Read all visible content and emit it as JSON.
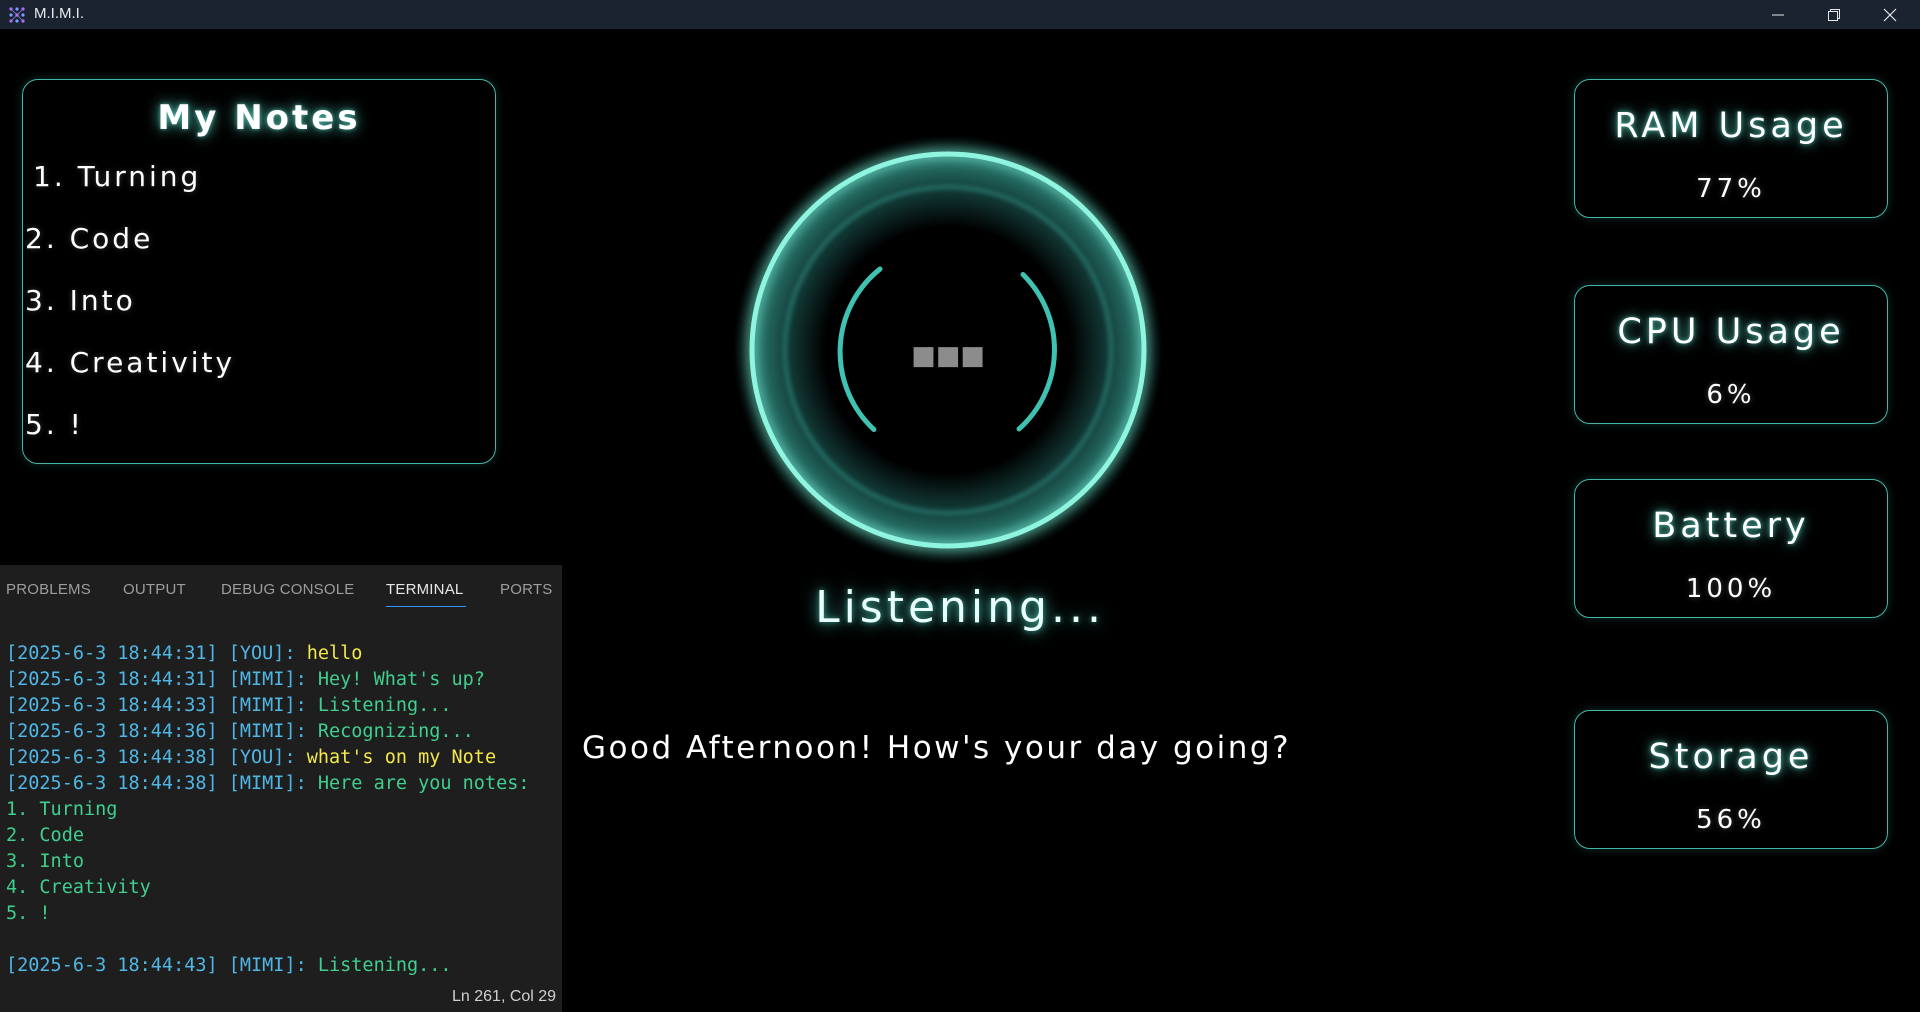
{
  "window": {
    "title": "M.I.M.I.",
    "icons": {
      "logo": "mimi-logo-icon",
      "minimize": "minimize-icon",
      "restore": "restore-icon",
      "close": "close-icon"
    }
  },
  "notes": {
    "title": "My Notes",
    "items": [
      "1. Turning",
      "2. Code",
      "3. Into",
      "4. Creativity",
      "5. !"
    ]
  },
  "assistant": {
    "status": "Listening...",
    "orb_center": "■■■",
    "greeting": "Good Afternoon! How's your day going?"
  },
  "stats": {
    "ram": {
      "label": "RAM Usage",
      "value": "77%"
    },
    "cpu": {
      "label": "CPU Usage",
      "value": "6%"
    },
    "battery": {
      "label": "Battery",
      "value": "100%"
    },
    "storage": {
      "label": "Storage",
      "value": "56%"
    }
  },
  "terminal": {
    "tabs": [
      "PROBLEMS",
      "OUTPUT",
      "DEBUG CONSOLE",
      "TERMINAL",
      "PORTS"
    ],
    "active_tab": "TERMINAL",
    "log": [
      {
        "prefix": "[2025-6-3 18:44:31] [YOU]: ",
        "text": "hello"
      },
      {
        "prefix": "[2025-6-3 18:44:31] [MIMI]: ",
        "text": "Hey! What's up?"
      },
      {
        "prefix": "[2025-6-3 18:44:33] [MIMI]: ",
        "text": "Listening..."
      },
      {
        "prefix": "[2025-6-3 18:44:36] [MIMI]: ",
        "text": "Recognizing..."
      },
      {
        "prefix": "[2025-6-3 18:44:38] [YOU]: ",
        "text": "what's on my Note"
      },
      {
        "prefix": "[2025-6-3 18:44:38] [MIMI]: ",
        "text": "Here are you notes:"
      },
      {
        "prefix": "",
        "text": "1. Turning"
      },
      {
        "prefix": "",
        "text": "2. Code"
      },
      {
        "prefix": "",
        "text": "3. Into"
      },
      {
        "prefix": "",
        "text": "4. Creativity"
      },
      {
        "prefix": "",
        "text": "5. !"
      },
      {
        "prefix": "",
        "text": ""
      },
      {
        "prefix": "[2025-6-3 18:44:43] [MIMI]: ",
        "text": "Listening..."
      }
    ],
    "status_position": "Ln 261, Col 29"
  },
  "colors": {
    "accent": "#3fb8a9",
    "glow": "#64f0dc",
    "terminal_timestamp": "#4fb7e6",
    "terminal_user": "#f5e84a",
    "terminal_mimi": "#3fcf8e"
  }
}
